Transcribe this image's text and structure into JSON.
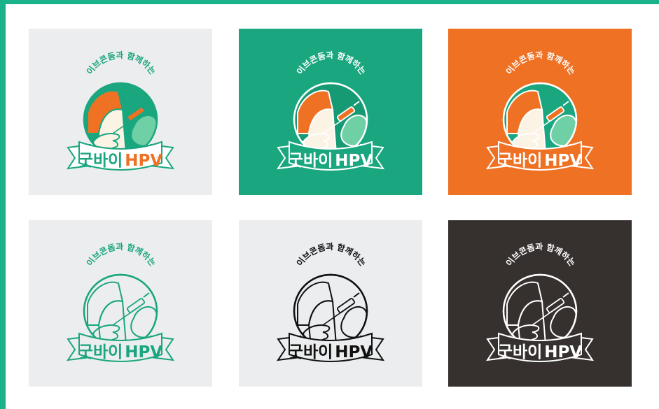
{
  "logo": {
    "subtitle": "이브콘돔과 함께하는",
    "title_korean": "굿바이",
    "title_latin": "HPV"
  },
  "colors": {
    "frame": "#19b28a",
    "green": "#1aa67f",
    "orange": "#ef7124",
    "light_gray": "#ecedee",
    "charcoal": "#36302f",
    "cream": "#fbf3e4",
    "white": "#ffffff",
    "black": "#111111"
  },
  "variants": [
    {
      "name": "full-color-on-light",
      "background": "light_gray",
      "style": "full color"
    },
    {
      "name": "full-color-on-green",
      "background": "green",
      "style": "full color"
    },
    {
      "name": "full-color-on-orange",
      "background": "orange",
      "style": "full color"
    },
    {
      "name": "green-line-on-light",
      "background": "light_gray",
      "style": "green line"
    },
    {
      "name": "black-line-on-light",
      "background": "light_gray",
      "style": "black line"
    },
    {
      "name": "white-line-on-charcoal",
      "background": "charcoal",
      "style": "white line"
    }
  ]
}
